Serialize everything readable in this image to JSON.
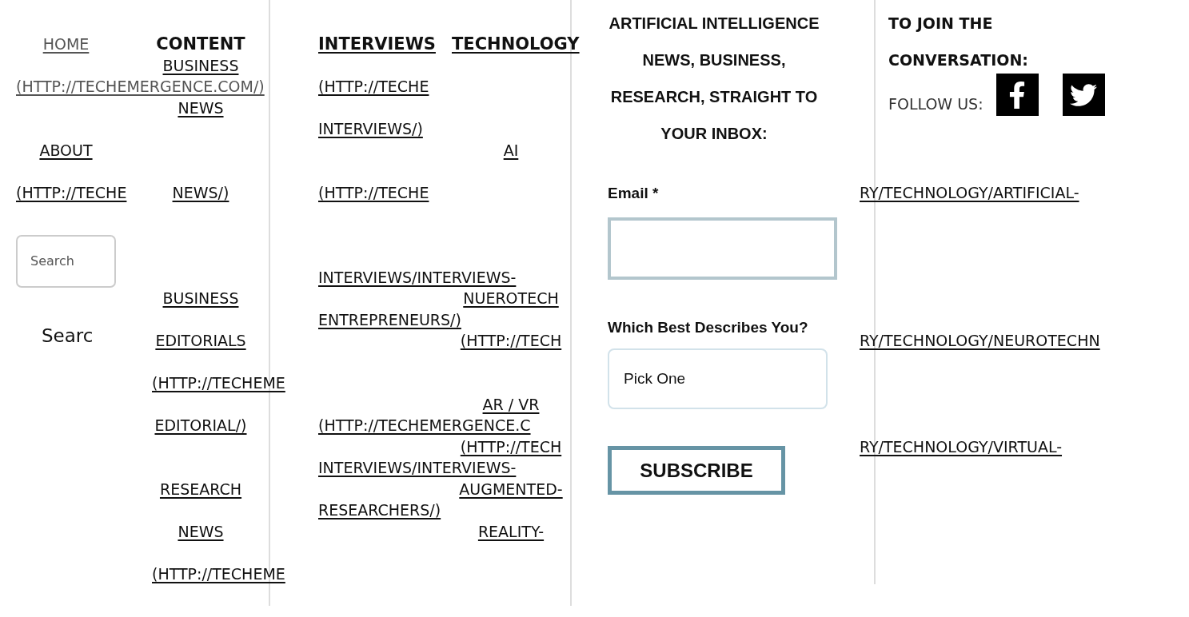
{
  "main_nav": {
    "items": [
      {
        "label": "HOME",
        "current": true
      },
      {
        "label": "(HTTP://TECHEMERGENCE.COM/)",
        "current": true
      },
      {
        "label": "ABOUT",
        "current": false
      },
      {
        "label": "(HTTP://TECHE",
        "current": false
      }
    ]
  },
  "search": {
    "placeholder": "Search",
    "button": "Searc"
  },
  "content_menu": {
    "title": "CONTENT",
    "items": [
      "BUSINESS",
      "NEWS",
      "NEWS/)",
      "BUSINESS",
      "EDITORIALS",
      "(HTTP://TECHEME",
      "EDITORIAL/)",
      "RESEARCH",
      "NEWS",
      "(HTTP://TECHEME"
    ]
  },
  "interviews_menu": {
    "title": "INTERVIEWS",
    "items": [
      "(HTTP://TECHE",
      "INTERVIEWS/)",
      "(HTTP://TECHE",
      "INTERVIEWS/INTERVIEWS-",
      "ENTREPRENEURS/)",
      "(HTTP://TECHEMERGENCE.C",
      "INTERVIEWS/INTERVIEWS-",
      "RESEARCHERS/)"
    ]
  },
  "technology_menu": {
    "title": "TECHNOLOGY",
    "items": [
      "AI",
      "NUEROTECH",
      "(HTTP://TECH",
      "AR / VR",
      "(HTTP://TECH",
      "AUGMENTED-",
      "REALITY-"
    ]
  },
  "newsletter": {
    "heading": "ARTIFICIAL INTELLIGENCE NEWS, BUSINESS, RESEARCH, STRAIGHT TO YOUR INBOX:",
    "email_label": "Email *",
    "role_label": "Which Best Describes You?",
    "role_value": "Pick One",
    "button": "SUBSCRIBE"
  },
  "social": {
    "heading": "TO JOIN THE CONVERSATION:",
    "follow_label": "FOLLOW US:"
  },
  "overflow_links": [
    "RY/TECHNOLOGY/ARTIFICIAL-",
    "RY/TECHNOLOGY/NEUROTECHN",
    "RY/TECHNOLOGY/VIRTUAL-"
  ]
}
